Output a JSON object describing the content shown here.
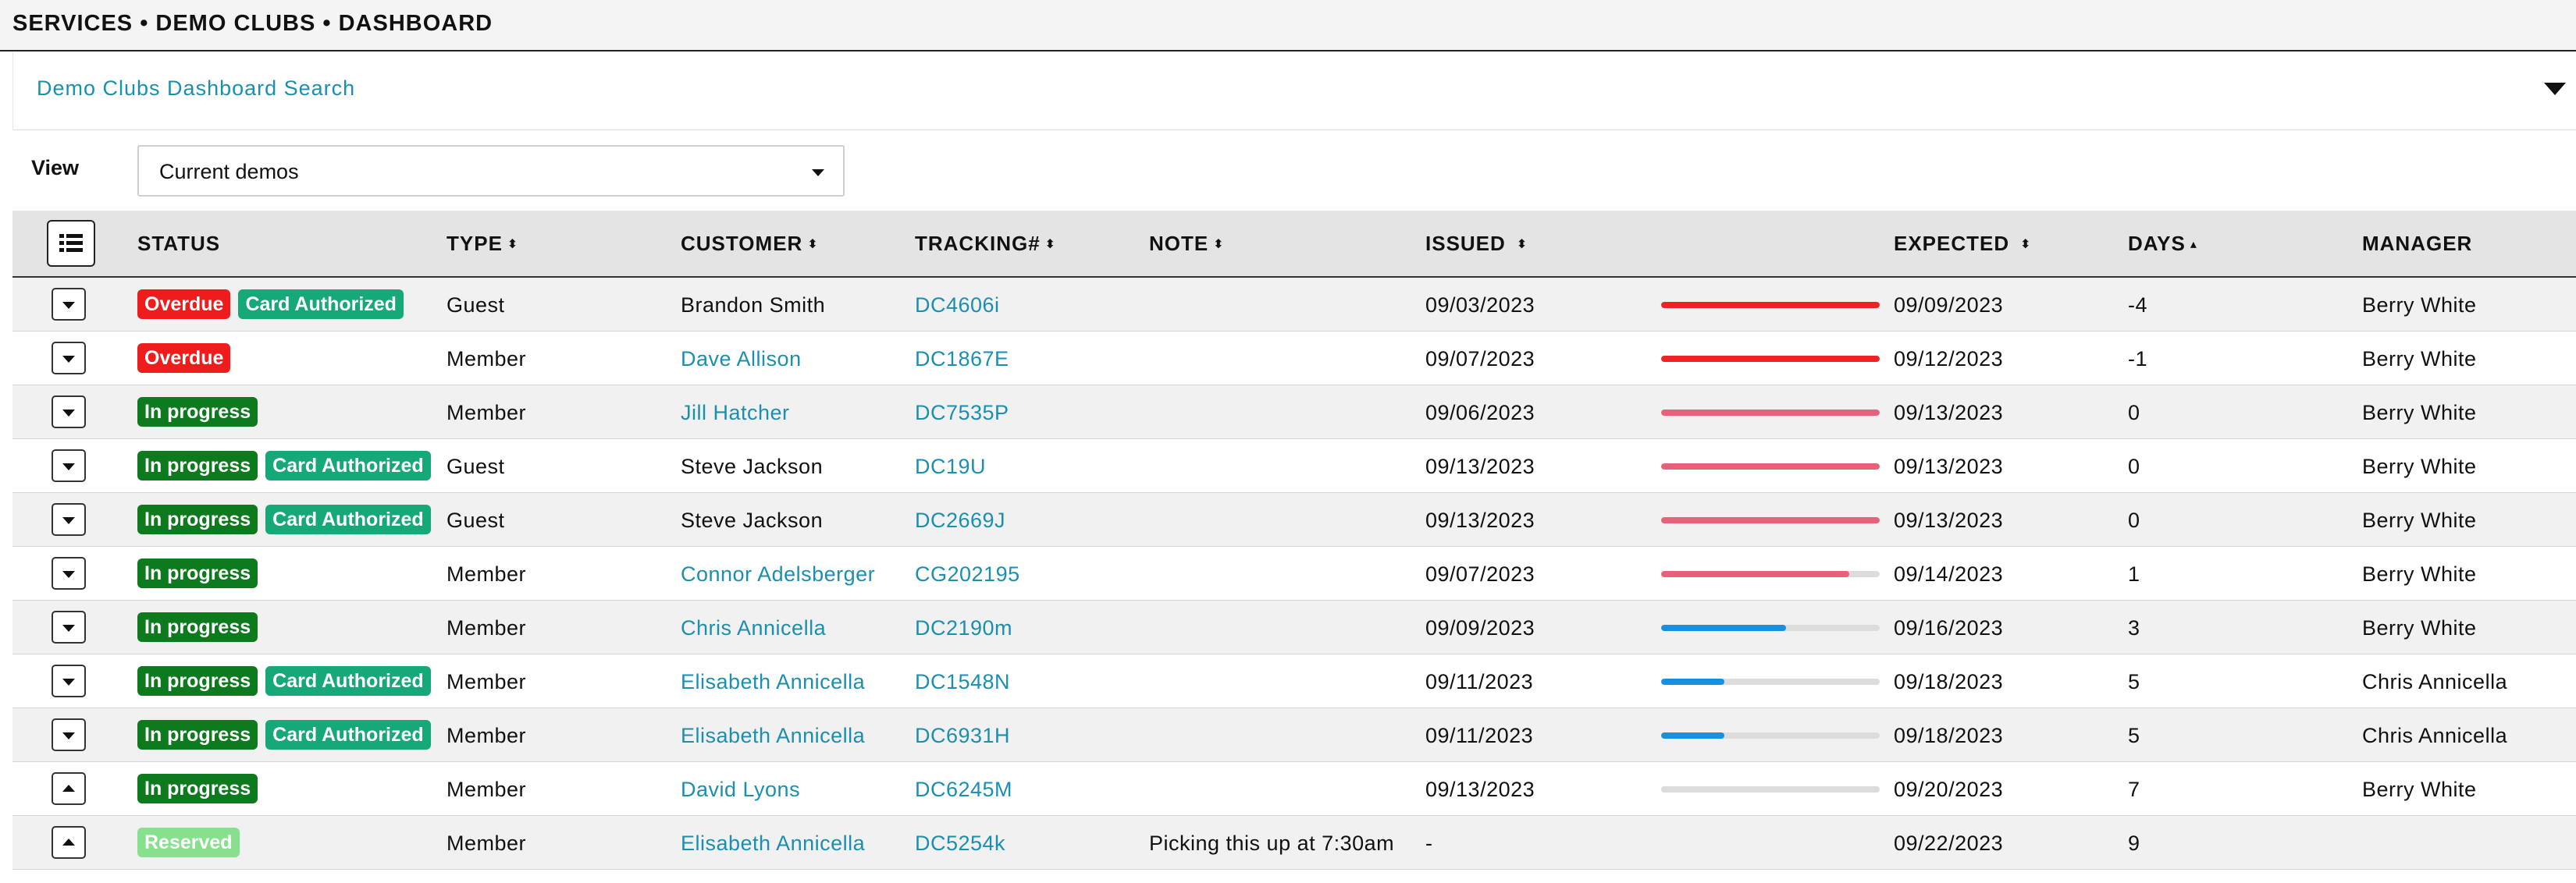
{
  "breadcrumb": "SERVICES • DEMO CLUBS • DASHBOARD",
  "search": {
    "title": "Demo Clubs Dashboard Search"
  },
  "view": {
    "label": "View",
    "selected": "Current demos"
  },
  "colors": {
    "overdue": "#ee1c1c",
    "in_progress": "#0e7a1e",
    "card_authorized": "#17a87a",
    "reserved": "#86e08d",
    "bar_red": "#ee2222",
    "bar_pink": "#e8607a",
    "bar_blue": "#1a8fe0",
    "link": "#1a8fb0"
  },
  "table": {
    "columns": {
      "status": "STATUS",
      "type": "TYPE",
      "customer": "CUSTOMER",
      "tracking": "TRACKING#",
      "note": "NOTE",
      "issued": "ISSUED",
      "expected": "EXPECTED",
      "days": "DAYS",
      "manager": "MANAGER"
    },
    "rows": [
      {
        "badges": [
          {
            "text": "Overdue",
            "kind": "overdue"
          },
          {
            "text": "Card Authorized",
            "kind": "card_authorized"
          }
        ],
        "type": "Guest",
        "customer": "Brandon Smith",
        "customer_link": false,
        "tracking": "DC4606i",
        "note": "",
        "issued": "09/03/2023",
        "progress": 1.0,
        "bar": "bar_red",
        "expected": "09/09/2023",
        "days": "-4",
        "manager": "Berry White",
        "expanded": false
      },
      {
        "badges": [
          {
            "text": "Overdue",
            "kind": "overdue"
          }
        ],
        "type": "Member",
        "customer": "Dave Allison",
        "customer_link": true,
        "tracking": "DC1867E",
        "note": "",
        "issued": "09/07/2023",
        "progress": 1.0,
        "bar": "bar_red",
        "expected": "09/12/2023",
        "days": "-1",
        "manager": "Berry White",
        "expanded": false
      },
      {
        "badges": [
          {
            "text": "In progress",
            "kind": "in_progress"
          }
        ],
        "type": "Member",
        "customer": "Jill Hatcher",
        "customer_link": true,
        "tracking": "DC7535P",
        "note": "",
        "issued": "09/06/2023",
        "progress": 1.0,
        "bar": "bar_pink",
        "expected": "09/13/2023",
        "days": "0",
        "manager": "Berry White",
        "expanded": false
      },
      {
        "badges": [
          {
            "text": "In progress",
            "kind": "in_progress"
          },
          {
            "text": "Card Authorized",
            "kind": "card_authorized"
          }
        ],
        "type": "Guest",
        "customer": "Steve Jackson",
        "customer_link": false,
        "tracking": "DC19U",
        "note": "",
        "issued": "09/13/2023",
        "progress": 1.0,
        "bar": "bar_pink",
        "expected": "09/13/2023",
        "days": "0",
        "manager": "Berry White",
        "expanded": false
      },
      {
        "badges": [
          {
            "text": "In progress",
            "kind": "in_progress"
          },
          {
            "text": "Card Authorized",
            "kind": "card_authorized"
          }
        ],
        "type": "Guest",
        "customer": "Steve Jackson",
        "customer_link": false,
        "tracking": "DC2669J",
        "note": "",
        "issued": "09/13/2023",
        "progress": 1.0,
        "bar": "bar_pink",
        "expected": "09/13/2023",
        "days": "0",
        "manager": "Berry White",
        "expanded": false
      },
      {
        "badges": [
          {
            "text": "In progress",
            "kind": "in_progress"
          }
        ],
        "type": "Member",
        "customer": "Connor Adelsberger",
        "customer_link": true,
        "tracking": "CG202195",
        "note": "",
        "issued": "09/07/2023",
        "progress": 0.86,
        "bar": "bar_pink",
        "expected": "09/14/2023",
        "days": "1",
        "manager": "Berry White",
        "expanded": false
      },
      {
        "badges": [
          {
            "text": "In progress",
            "kind": "in_progress"
          }
        ],
        "type": "Member",
        "customer": "Chris Annicella",
        "customer_link": true,
        "tracking": "DC2190m",
        "note": "",
        "issued": "09/09/2023",
        "progress": 0.57,
        "bar": "bar_blue",
        "expected": "09/16/2023",
        "days": "3",
        "manager": "Berry White",
        "expanded": false
      },
      {
        "badges": [
          {
            "text": "In progress",
            "kind": "in_progress"
          },
          {
            "text": "Card Authorized",
            "kind": "card_authorized"
          }
        ],
        "type": "Member",
        "customer": "Elisabeth Annicella",
        "customer_link": true,
        "tracking": "DC1548N",
        "note": "",
        "issued": "09/11/2023",
        "progress": 0.29,
        "bar": "bar_blue",
        "expected": "09/18/2023",
        "days": "5",
        "manager": "Chris Annicella",
        "expanded": false
      },
      {
        "badges": [
          {
            "text": "In progress",
            "kind": "in_progress"
          },
          {
            "text": "Card Authorized",
            "kind": "card_authorized"
          }
        ],
        "type": "Member",
        "customer": "Elisabeth Annicella",
        "customer_link": true,
        "tracking": "DC6931H",
        "note": "",
        "issued": "09/11/2023",
        "progress": 0.29,
        "bar": "bar_blue",
        "expected": "09/18/2023",
        "days": "5",
        "manager": "Chris Annicella",
        "expanded": false
      },
      {
        "badges": [
          {
            "text": "In progress",
            "kind": "in_progress"
          }
        ],
        "type": "Member",
        "customer": "David Lyons",
        "customer_link": true,
        "tracking": "DC6245M",
        "note": "",
        "issued": "09/13/2023",
        "progress": 0.0,
        "bar": "bar_blue",
        "expected": "09/20/2023",
        "days": "7",
        "manager": "Berry White",
        "expanded": true
      },
      {
        "badges": [
          {
            "text": "Reserved",
            "kind": "reserved"
          }
        ],
        "type": "Member",
        "customer": "Elisabeth Annicella",
        "customer_link": true,
        "tracking": "DC5254k",
        "note": "Picking this up at 7:30am",
        "issued": "-",
        "progress": null,
        "bar": "",
        "expected": "09/22/2023",
        "days": "9",
        "manager": "",
        "expanded": true
      }
    ]
  }
}
